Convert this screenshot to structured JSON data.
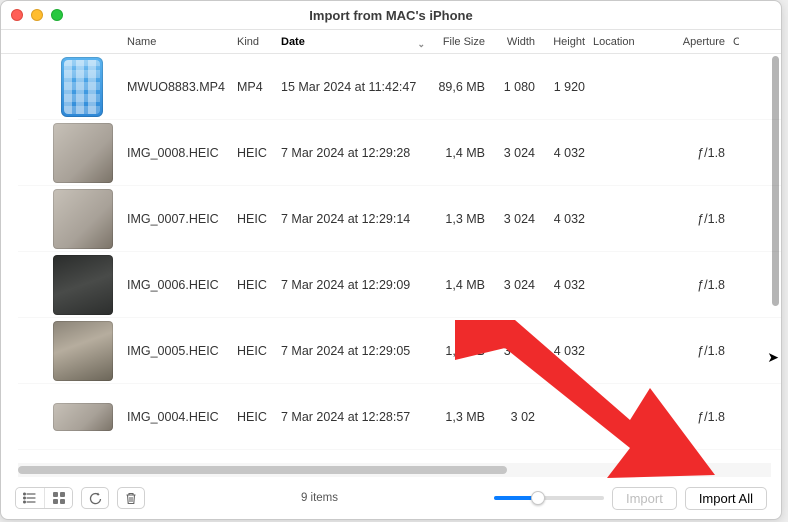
{
  "colors": {
    "accent": "#0a7dff",
    "annotation": "#ef2b2b"
  },
  "window": {
    "title": "Import from MAC's iPhone"
  },
  "columns": {
    "name": "Name",
    "kind": "Kind",
    "date": "Date",
    "file_size": "File Size",
    "width": "Width",
    "height": "Height",
    "location": "Location",
    "aperture": "Aperture",
    "extra": "C"
  },
  "files": [
    {
      "name": "MWUO8883.MP4",
      "kind": "MP4",
      "date": "15 Mar 2024 at 11:42:47",
      "size": "89,6 MB",
      "width": "1 080",
      "height": "1 920",
      "aperture": "",
      "thumb_style": "phone"
    },
    {
      "name": "IMG_0008.HEIC",
      "kind": "HEIC",
      "date": "7 Mar 2024 at 12:29:28",
      "size": "1,4 MB",
      "width": "3 024",
      "height": "4 032",
      "aperture": "ƒ/1.8",
      "thumb_style": "normal"
    },
    {
      "name": "IMG_0007.HEIC",
      "kind": "HEIC",
      "date": "7 Mar 2024 at 12:29:14",
      "size": "1,3 MB",
      "width": "3 024",
      "height": "4 032",
      "aperture": "ƒ/1.8",
      "thumb_style": "normal"
    },
    {
      "name": "IMG_0006.HEIC",
      "kind": "HEIC",
      "date": "7 Mar 2024 at 12:29:09",
      "size": "1,4 MB",
      "width": "3 024",
      "height": "4 032",
      "aperture": "ƒ/1.8",
      "thumb_style": "dark"
    },
    {
      "name": "IMG_0005.HEIC",
      "kind": "HEIC",
      "date": "7 Mar 2024 at 12:29:05",
      "size": "1,6 MB",
      "width": "3 024",
      "height": "4 032",
      "aperture": "ƒ/1.8",
      "thumb_style": "mixed"
    },
    {
      "name": "IMG_0004.HEIC",
      "kind": "HEIC",
      "date": "7 Mar 2024 at 12:28:57",
      "size": "1,3 MB",
      "width": "3 02",
      "height": "",
      "aperture": "ƒ/1.8",
      "thumb_style": "normal"
    }
  ],
  "status": {
    "count_text": "9 items"
  },
  "actions": {
    "import": "Import",
    "import_all": "Import All"
  }
}
